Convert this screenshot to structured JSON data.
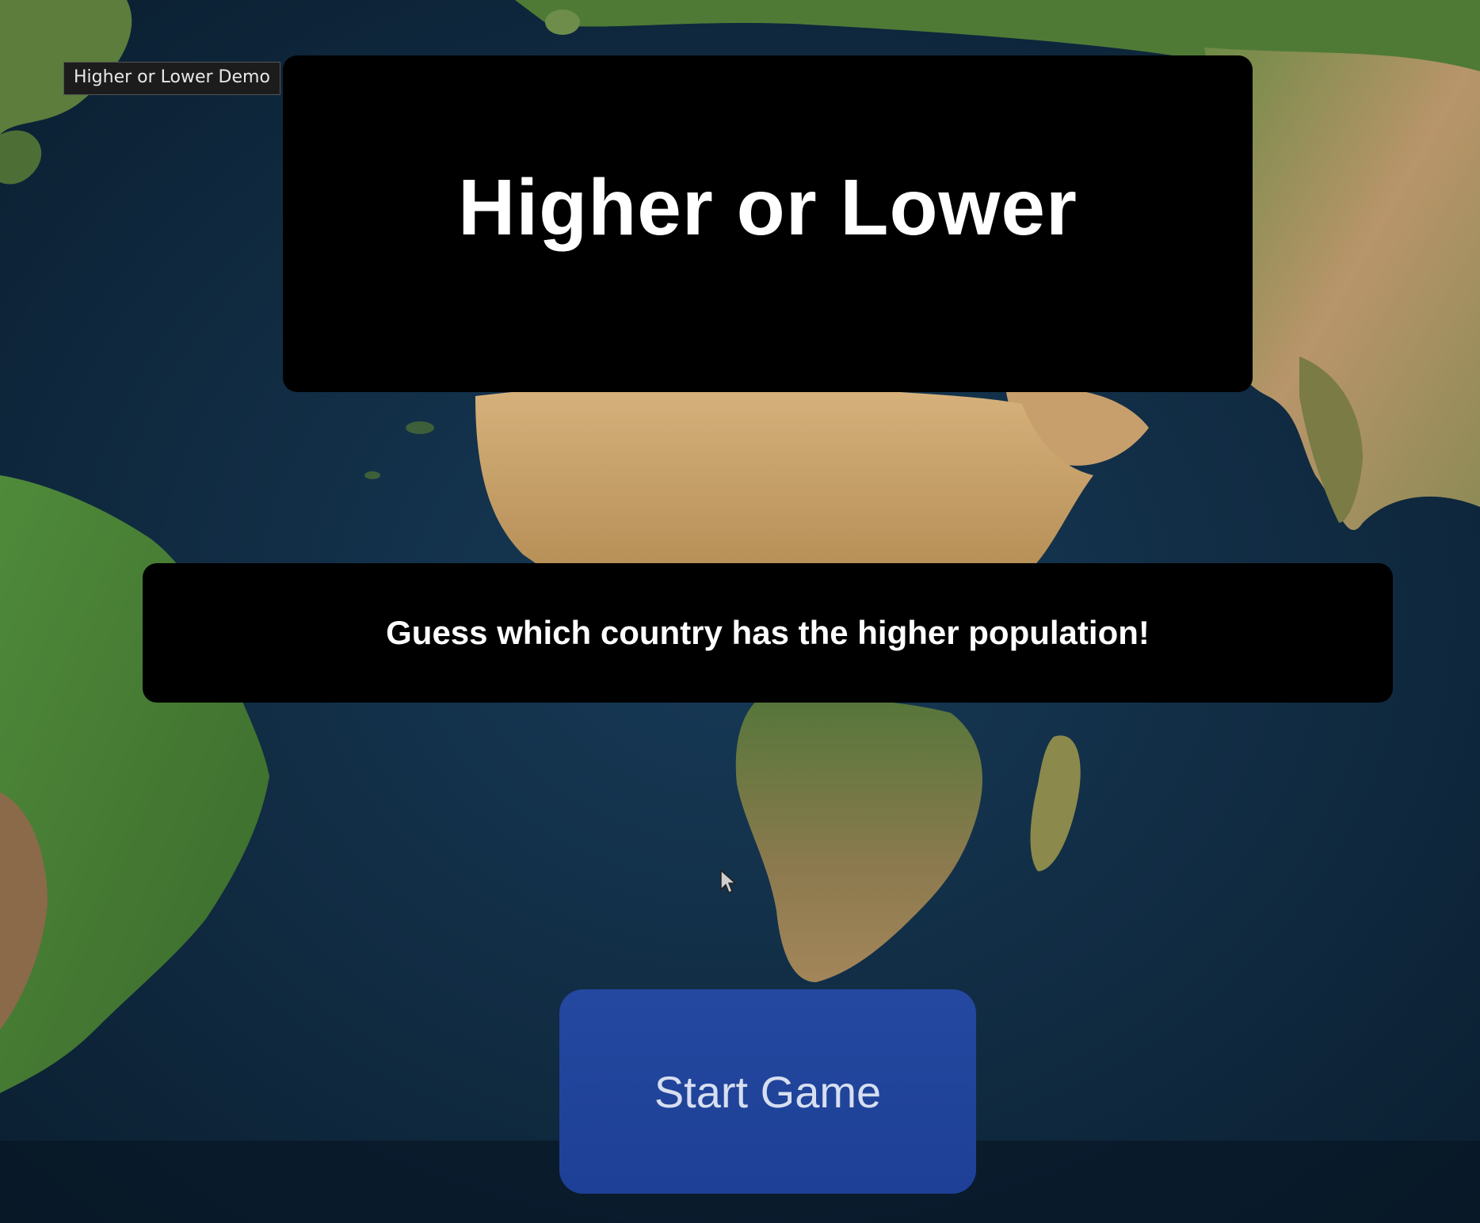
{
  "tooltip": {
    "text": "Higher or Lower Demo"
  },
  "title": {
    "text": "Higher or Lower"
  },
  "subtitle": {
    "text": "Guess which country has the higher population!"
  },
  "start_button": {
    "label": "Start Game"
  },
  "background": {
    "description_icon": "world-map-satellite-background"
  },
  "colors": {
    "panel": "#000000",
    "button": "#2346a0",
    "button_text": "#d7dff0",
    "ocean": "#0d2438"
  }
}
